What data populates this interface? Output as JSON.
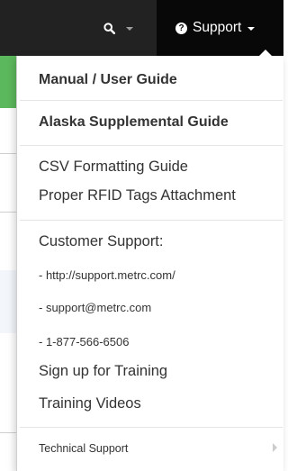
{
  "navbar": {
    "search_icon": "search-icon",
    "support_icon": "question-circle-icon",
    "support_label": "Support"
  },
  "support_menu": {
    "manual_guide": "Manual / User Guide",
    "alaska_guide": "Alaska Supplemental Guide",
    "csv_guide": "CSV Formatting Guide",
    "rfid_guide": "Proper RFID Tags Attachment",
    "customer_support_heading": "Customer Support:",
    "support_url": "- http://support.metrc.com/",
    "support_email": "- support@metrc.com",
    "support_phone": "- 1-877-566-6506",
    "sign_up_training": "Sign up for Training",
    "training_videos": "Training Videos",
    "technical_support": "Technical Support"
  },
  "colors": {
    "navbar_bg": "#222222",
    "active_nav_bg": "#080808",
    "accent_green": "#5cb85c",
    "menu_text": "#333333"
  }
}
